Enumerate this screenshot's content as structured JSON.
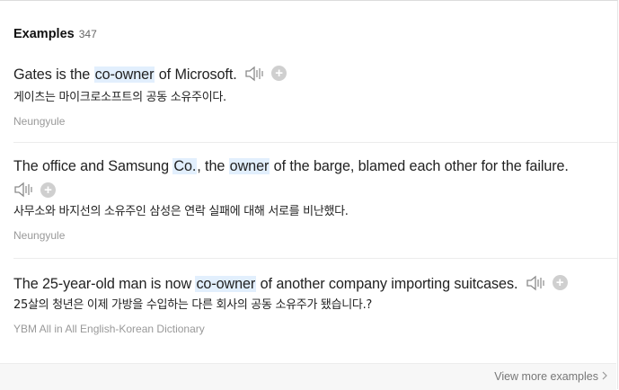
{
  "header": {
    "title": "Examples",
    "count": "347"
  },
  "examples": [
    {
      "en": [
        "Gates is the ",
        {
          "hl": "co-owner"
        },
        " of Microsoft."
      ],
      "ko": "게이츠는 마이크로소프트의 공동 소유주이다.",
      "source": "Neungyule"
    },
    {
      "en": [
        "The office and Samsung ",
        {
          "hl": "Co."
        },
        ", the ",
        {
          "hl": "owner"
        },
        " of the barge, blamed each other for the failure."
      ],
      "ko": "사무소와 바지선의 소유주인 삼성은 연락 실패에 대해 서로를 비난했다.",
      "source": "Neungyule"
    },
    {
      "en": [
        "The 25-year-old man is now ",
        {
          "hl": "co-owner"
        },
        " of another company importing suitcases."
      ],
      "ko": "25살의 청년은 이제 가방을 수입하는 다른 회사의 공동 소유주가 됐습니다.?",
      "source": "YBM All in All English-Korean Dictionary"
    }
  ],
  "footer": {
    "more_label": "View more examples"
  },
  "icons": {
    "speaker": "speaker-icon",
    "add": "plus-icon",
    "more": "chevron-right-icon"
  }
}
